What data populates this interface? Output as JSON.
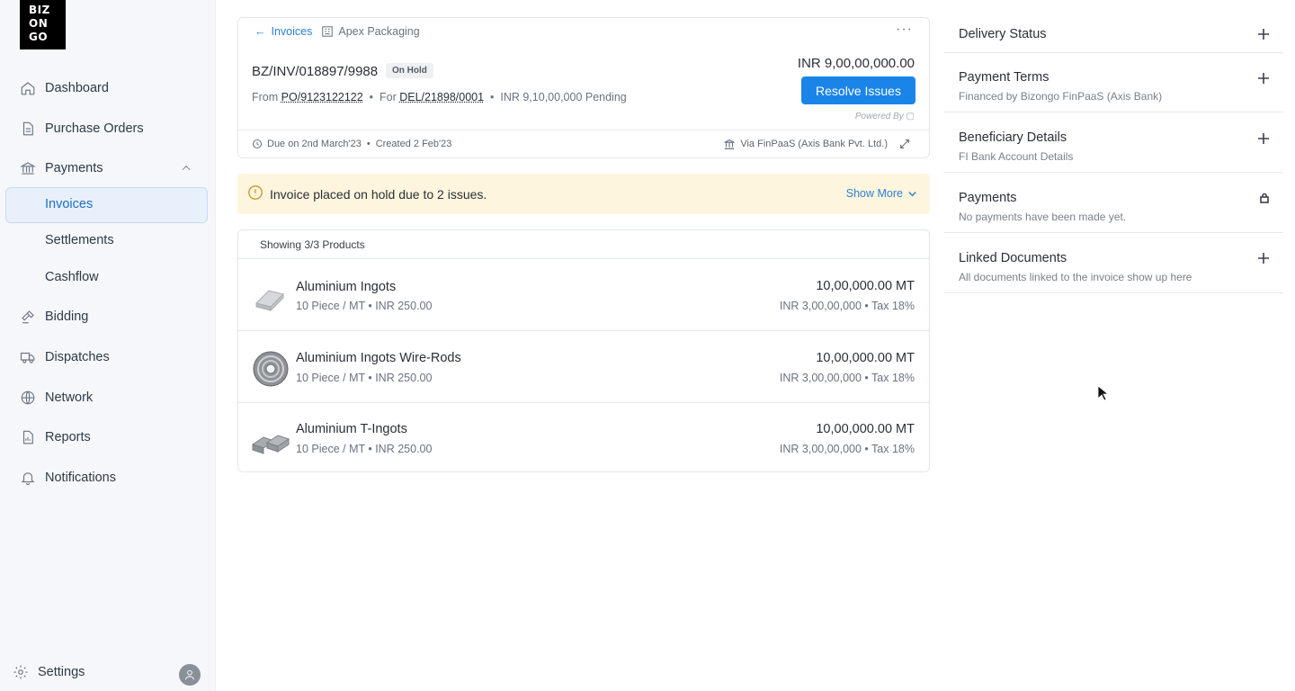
{
  "brand": {
    "logo_line1": "BIZ",
    "logo_line2": "ON",
    "logo_line3": "GO"
  },
  "sidebar": {
    "items": [
      {
        "label": "Dashboard",
        "icon": "home-icon"
      },
      {
        "label": "Purchase Orders",
        "icon": "document-icon"
      },
      {
        "label": "Payments",
        "icon": "bank-icon"
      },
      {
        "label": "Bidding",
        "icon": "gavel-icon"
      },
      {
        "label": "Dispatches",
        "icon": "truck-icon"
      },
      {
        "label": "Network",
        "icon": "globe-icon"
      },
      {
        "label": "Reports",
        "icon": "report-icon"
      },
      {
        "label": "Notifications",
        "icon": "bell-icon"
      }
    ],
    "payments_sub": [
      {
        "label": "Invoices",
        "active": true
      },
      {
        "label": "Settlements",
        "active": false
      },
      {
        "label": "Cashflow",
        "active": false
      }
    ],
    "settings_label": "Settings"
  },
  "invoice": {
    "breadcrumb_back": "←",
    "breadcrumb_link": "Invoices",
    "vendor": "Apex Packaging",
    "more": "···",
    "number": "BZ/INV/018897/9988",
    "status": "On Hold",
    "from_label": "From",
    "po": "PO/9123122122",
    "for_label": "For",
    "del": "DEL/21898/0001",
    "pending": "INR 9,10,00,000 Pending",
    "amount": "INR 9,00,00,000.00",
    "resolve_label": "Resolve Issues",
    "powered_by": "Powered By",
    "due": "Due on 2nd March'23",
    "created": "Created 2 Feb'23",
    "via": "Via FinPaaS (Axis Bank Pvt. Ltd.)"
  },
  "alert": {
    "text": "Invoice placed on hold due to 2 issues.",
    "show_more": "Show More"
  },
  "products": {
    "heading": "Showing 3/3 Products",
    "rows": [
      {
        "name": "Aluminium Ingots",
        "unit": "10 Piece / MT • INR 250.00",
        "qty": "10,00,000.00 MT",
        "price": "INR 3,00,00,000 • Tax 18%",
        "thumb": "ingot-icon"
      },
      {
        "name": "Aluminium Ingots Wire-Rods",
        "unit": "10 Piece / MT • INR 250.00",
        "qty": "10,00,000.00 MT",
        "price": "INR 3,00,00,000 • Tax 18%",
        "thumb": "wire-coil-icon"
      },
      {
        "name": "Aluminium T-Ingots",
        "unit": "10 Piece / MT • INR 250.00",
        "qty": "10,00,000.00 MT",
        "price": "INR 3,00,00,000 • Tax 18%",
        "thumb": "t-ingot-icon"
      }
    ]
  },
  "side_panel": [
    {
      "title": "Delivery Status",
      "subtitle": "",
      "action": "plus-icon"
    },
    {
      "title": "Payment Terms",
      "subtitle": "Financed by Bizongo FinPaaS (Axis Bank)",
      "action": "plus-icon"
    },
    {
      "title": "Beneficiary Details",
      "subtitle": "FI Bank Account Details",
      "action": "plus-icon"
    },
    {
      "title": "Payments",
      "subtitle": "No payments have been made yet.",
      "action": "lock-icon"
    },
    {
      "title": "Linked Documents",
      "subtitle": "All documents linked to the invoice show up here",
      "action": "plus-icon"
    }
  ],
  "colors": {
    "accent": "#1a84e8",
    "alert_bg": "#fdf5dd",
    "sidebar_bg": "#f5f7fa"
  }
}
